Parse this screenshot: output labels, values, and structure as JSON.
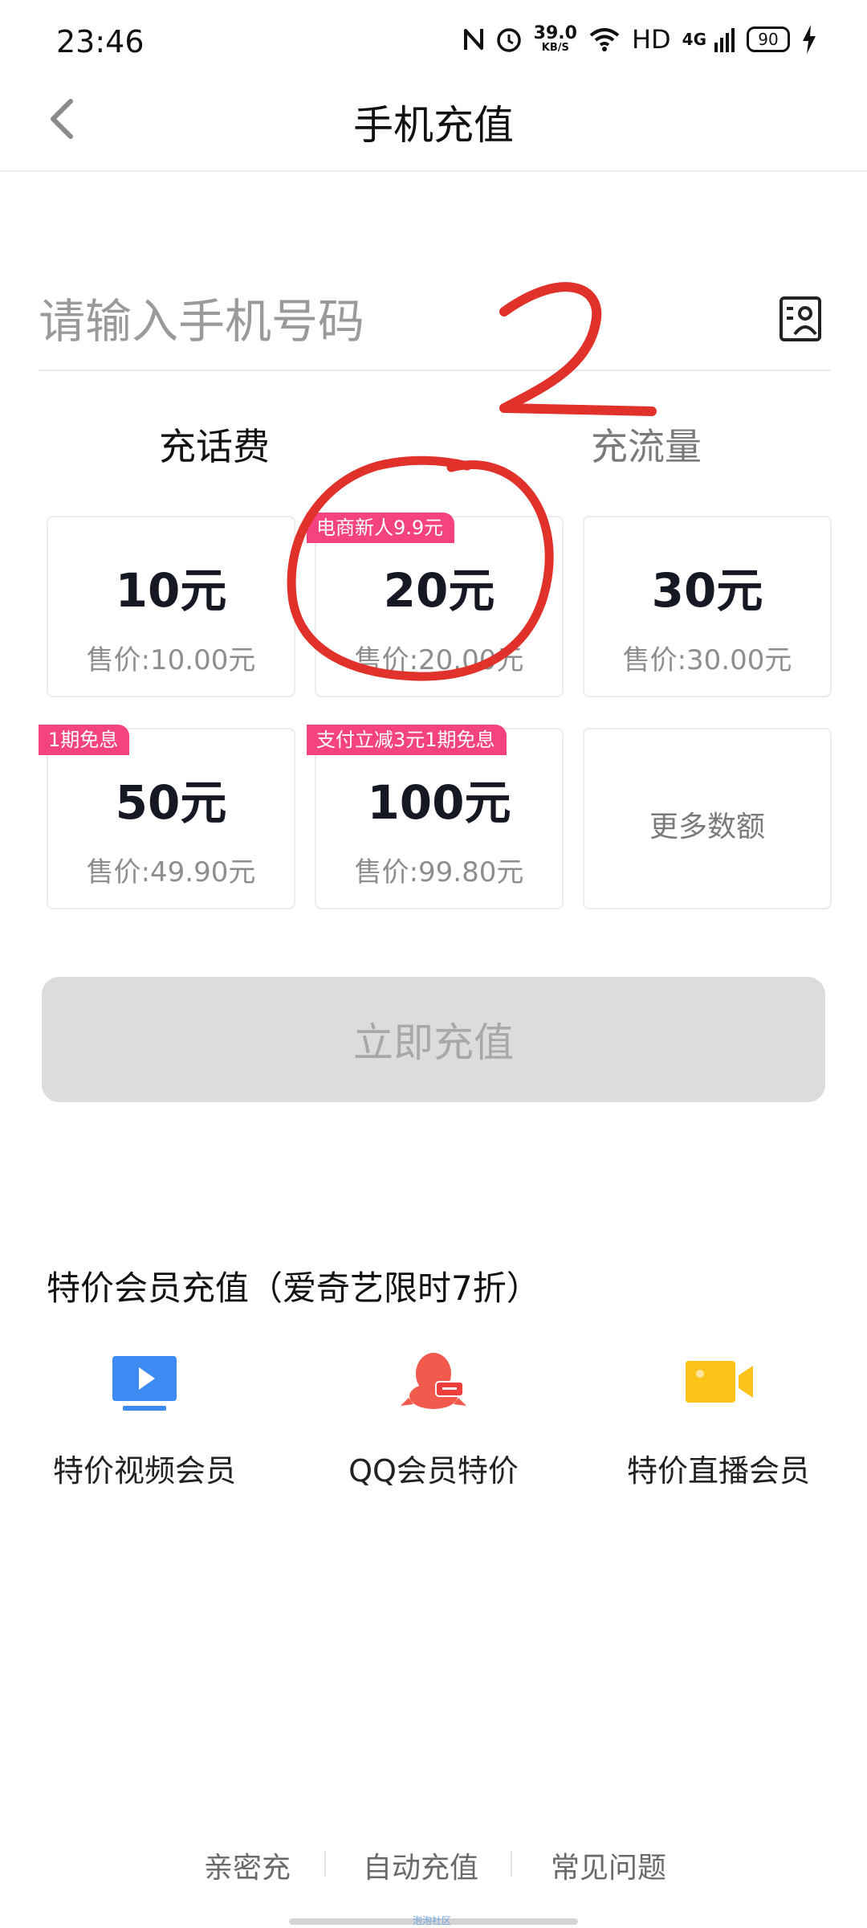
{
  "status_bar": {
    "time": "23:46",
    "net_speed": "39.0",
    "net_unit": "KB/S",
    "hd": "HD",
    "network": "4G",
    "battery": "90",
    "icons": [
      "nfc-icon",
      "alarm-icon",
      "wifi-icon",
      "signal-icon",
      "battery-icon",
      "charging-icon"
    ]
  },
  "header": {
    "title": "手机充值",
    "back_icon": "chevron-left-icon"
  },
  "phone_input": {
    "placeholder": "请输入手机号码",
    "value": "",
    "contacts_icon": "contacts-book-icon"
  },
  "tabs": [
    {
      "label": "充话费",
      "active": true
    },
    {
      "label": "充流量",
      "active": false
    }
  ],
  "annotations": {
    "handwritten": "2",
    "color": "#e0312b"
  },
  "options": [
    {
      "amount": "10元",
      "price": "售价:10.00元",
      "badge": ""
    },
    {
      "amount": "20元",
      "price": "售价:20.00元",
      "badge": "电商新人9.9元"
    },
    {
      "amount": "30元",
      "price": "售价:30.00元",
      "badge": ""
    },
    {
      "amount": "50元",
      "price": "售价:49.90元",
      "badge": "1期免息"
    },
    {
      "amount": "100元",
      "price": "售价:99.80元",
      "badge": "支付立减3元1期免息"
    },
    {
      "more": "更多数额"
    }
  ],
  "recharge_button": {
    "label": "立即充值",
    "enabled": false
  },
  "membership": {
    "title": "特价会员充值（爱奇艺限时7折）",
    "items": [
      {
        "label": "特价视频会员",
        "icon": "video-play-icon",
        "color": "#3d8bf2"
      },
      {
        "label": "QQ会员特价",
        "icon": "qq-penguin-icon",
        "color": "#f25a4e"
      },
      {
        "label": "特价直播会员",
        "icon": "live-camera-icon",
        "color": "#fcc419"
      }
    ]
  },
  "footer": {
    "links": [
      "亲密充",
      "自动充值",
      "常见问题"
    ],
    "watermark": "泡泡社区"
  },
  "colors": {
    "badge": "#f4437f",
    "amount_text": "#161823",
    "disabled_button": "#dcdcdc"
  }
}
